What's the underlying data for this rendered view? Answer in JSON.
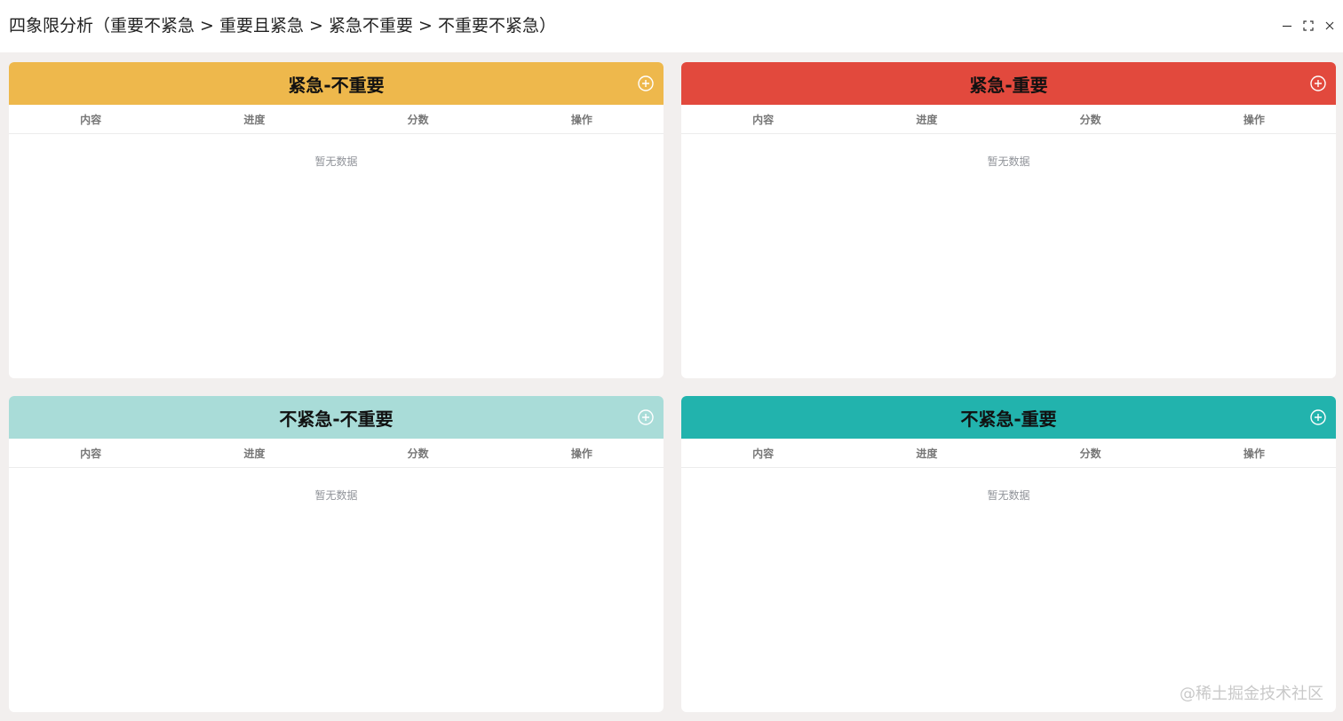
{
  "window": {
    "title": "四象限分析（重要不紧急 > 重要且紧急 > 紧急不重要 > 不重要不紧急）"
  },
  "columns": [
    "内容",
    "进度",
    "分数",
    "操作"
  ],
  "empty_text": "暂无数据",
  "quadrants": [
    {
      "title": "紧急-不重要",
      "color": "#eeb84c"
    },
    {
      "title": "紧急-重要",
      "color": "#e2493d"
    },
    {
      "title": "不紧急-不重要",
      "color": "#a9dcd8"
    },
    {
      "title": "不紧急-重要",
      "color": "#22b3ad"
    }
  ],
  "icons": {
    "minimize": "minimize-icon",
    "maximize": "maximize-icon",
    "close": "close-icon",
    "add": "plus-circle-icon"
  },
  "watermark": "@稀土掘金技术社区"
}
